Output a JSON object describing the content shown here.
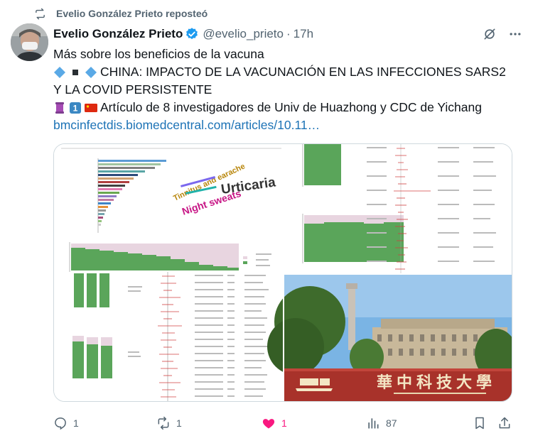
{
  "repost": {
    "text": "Evelio González Prieto reposteó"
  },
  "tweet": {
    "author": "Evelio González Prieto",
    "handle": "@evelio_prieto",
    "separator": "·",
    "time": "17h",
    "line1": "Más sobre los beneficios de la vacuna",
    "line2": "CHINA: IMPACTO DE LA VACUNACIÓN EN LAS INFECCIONES SARS2",
    "line3": "Y LA COVID PERSISTENTE",
    "line4": "Artículo de 8 investigadores de Univ de Huazhong y CDC de Yichang",
    "link": "bmcinfectdis.biomedcentral.com/articles/10.11…"
  },
  "media": {
    "photo_sign_text": "華中科技大學",
    "wordcloud": [
      "Urticaria",
      "Tinnitus and earache",
      "Night sweats"
    ]
  },
  "actions": {
    "replies": "1",
    "reposts": "1",
    "likes": "1",
    "views": "87"
  },
  "colors": {
    "verified": "#1d9bf0",
    "like": "#f91880",
    "link": "#1d73b6",
    "muted": "#536471"
  }
}
